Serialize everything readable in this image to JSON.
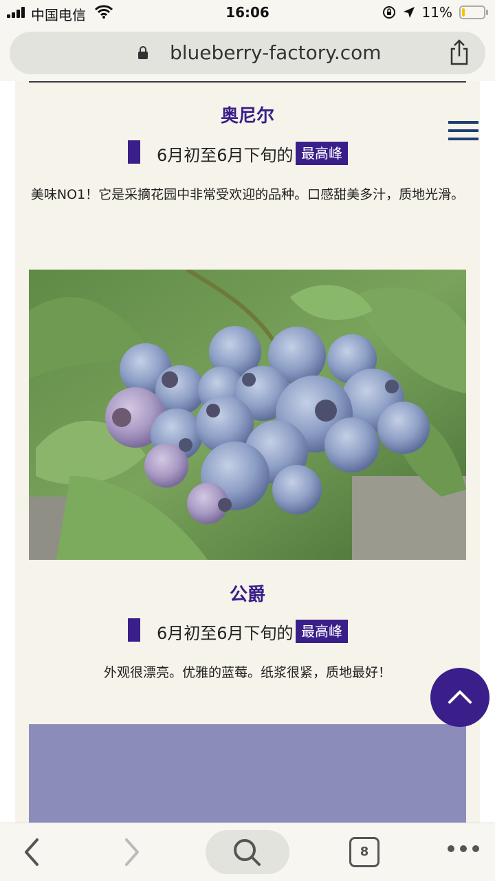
{
  "status_bar": {
    "carrier": "中国电信",
    "time": "16:06",
    "battery_percent": "11%",
    "battery_level": 0.11
  },
  "browser": {
    "url": "blueberry-factory.com",
    "tab_count": "8"
  },
  "page": {
    "varieties": [
      {
        "name": "奥尼尔",
        "season": "6月初至6月下旬的",
        "badge": "最高峰",
        "description": "美味NO1！它是采摘花园中非常受欢迎的品种。口感甜美多汁，质地光滑。"
      },
      {
        "name": "公爵",
        "season": "6月初至6月下旬的",
        "badge": "最高峰",
        "description": "外观很漂亮。优雅的蓝莓。纸浆很紧，质地最好！"
      }
    ]
  },
  "icons": [
    "signal-icon",
    "wifi-icon",
    "lock-icon",
    "share-icon",
    "menu-icon",
    "arrow-up-icon",
    "back-icon",
    "forward-icon",
    "search-icon",
    "tabs-icon",
    "more-icon"
  ],
  "colors": {
    "accent": "#3a1f8a",
    "page_background": "#f6f3ea",
    "placeholder_box": "#8c8cbb",
    "menu_icon": "#1f3d72"
  }
}
